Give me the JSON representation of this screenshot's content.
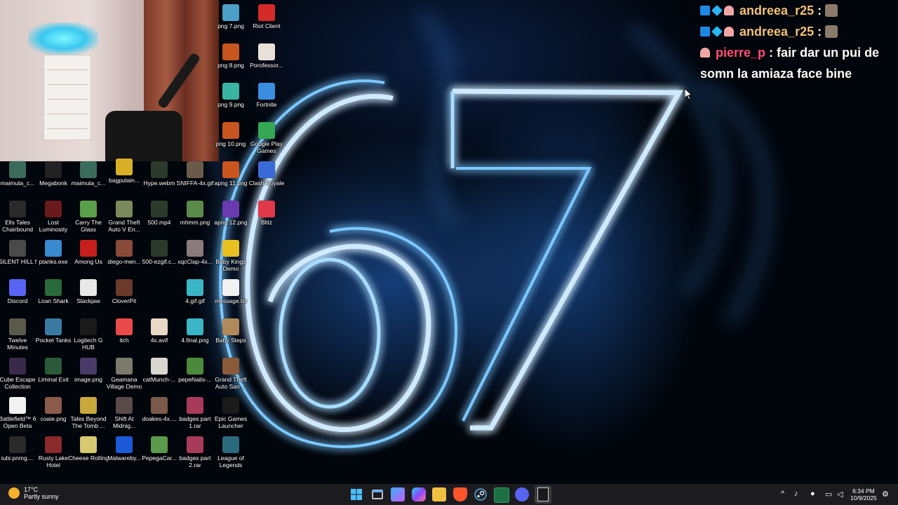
{
  "desktop": {
    "icons": [
      {
        "label": "png 7.png",
        "icon": "skull-icon",
        "color": "#4aa0c8"
      },
      {
        "label": "Riot Client",
        "icon": "riot-icon",
        "color": "#d42a2a"
      },
      {
        "label": "png 8.png",
        "icon": "skull-icon",
        "color": "#c8551e"
      },
      {
        "label": "Porofessor...",
        "icon": "poro-icon",
        "color": "#e8e0d8"
      },
      {
        "label": "png 9.png",
        "icon": "skull-icon",
        "color": "#3ab5a5"
      },
      {
        "label": "Fortnite",
        "icon": "fortnite-icon",
        "color": "#3b8de0"
      },
      {
        "label": "png 10.png",
        "icon": "skull-icon",
        "color": "#c8551e"
      },
      {
        "label": "Google Play Games",
        "icon": "play-games-icon",
        "color": "#34a853"
      },
      {
        "label": "maimuta_c...",
        "icon": "monkey-icon",
        "color": "#3b6b5a"
      },
      {
        "label": "Megabonk",
        "icon": "megabonk-icon",
        "color": "#222222"
      },
      {
        "label": "maimuta_c...",
        "icon": "monkey-icon",
        "color": "#3b6b5a"
      },
      {
        "label": "bagpulain...",
        "icon": "gold-bar-icon",
        "color": "#d8b028"
      },
      {
        "label": "Hype.webm",
        "icon": "video-icon",
        "color": "#2c3a2c"
      },
      {
        "label": "SNIFFA-4x.gif",
        "icon": "image-icon",
        "color": "#6a5a4a"
      },
      {
        "label": "apng 11.png",
        "icon": "skull-icon",
        "color": "#c8551e"
      },
      {
        "label": "Clash Royale",
        "icon": "clash-royale-icon",
        "color": "#3a6ad8"
      },
      {
        "label": "Ells Tales Chairbound",
        "icon": "game-icon",
        "color": "#2a2a2a"
      },
      {
        "label": "Lost Luminosity",
        "icon": "game-icon",
        "color": "#6a1a1a"
      },
      {
        "label": "Carry The Glass",
        "icon": "game-icon",
        "color": "#5aa04a"
      },
      {
        "label": "Grand Theft Auto V En...",
        "icon": "gta-icon",
        "color": "#7a8a5a"
      },
      {
        "label": "500.mp4",
        "icon": "video-icon",
        "color": "#2c3a2c"
      },
      {
        "label": "mhmm.png",
        "icon": "image-icon",
        "color": "#5a8a4a"
      },
      {
        "label": "apng 12.png",
        "icon": "skull-icon",
        "color": "#6a3ab0"
      },
      {
        "label": "Blitz",
        "icon": "blitz-icon",
        "color": "#e03a4a"
      },
      {
        "label": "SILENT HILL f",
        "icon": "game-icon",
        "color": "#4a4a4a"
      },
      {
        "label": "ptanks.exe",
        "icon": "tank-icon",
        "color": "#3a8ad0"
      },
      {
        "label": "Among Us",
        "icon": "among-us-icon",
        "color": "#c81e1e"
      },
      {
        "label": "diego-men...",
        "icon": "image-icon",
        "color": "#8a4a3a"
      },
      {
        "label": "500-ezgif.c...",
        "icon": "video-icon",
        "color": "#2c3a2c"
      },
      {
        "label": "xqcClap-4x...",
        "icon": "image-icon",
        "color": "#8a7a7a"
      },
      {
        "label": "Baby Kings Demo",
        "icon": "crown-icon",
        "color": "#e8c020"
      },
      {
        "label": "Discord",
        "icon": "discord-icon",
        "color": "#5865f2"
      },
      {
        "label": "Loan Shark",
        "icon": "game-icon",
        "color": "#2a6a3a"
      },
      {
        "label": "Slackjaw",
        "icon": "game-icon",
        "color": "#e8e8e8"
      },
      {
        "label": "CloverPit",
        "icon": "game-icon",
        "color": "#6a3a2a"
      },
      {
        "label": "4.gif.gif",
        "icon": "skull-icon",
        "color": "#3ab5c5"
      },
      {
        "label": "message.txt",
        "icon": "text-file-icon",
        "color": "#f2f2f2"
      },
      {
        "label": "Twelve Minutes",
        "icon": "game-icon",
        "color": "#5a5a4a"
      },
      {
        "label": "Pocket Tanks",
        "icon": "tank-icon",
        "color": "#3a7aa0"
      },
      {
        "label": "Logitech G HUB",
        "icon": "logitech-icon",
        "color": "#1a1a1a"
      },
      {
        "label": "itch",
        "icon": "itch-icon",
        "color": "#e84a4a"
      },
      {
        "label": "4x.avif",
        "icon": "image-icon",
        "color": "#e8d8c8"
      },
      {
        "label": "4.final.png",
        "icon": "skull-icon",
        "color": "#3ab5c5"
      },
      {
        "label": "Baby Steps",
        "icon": "game-icon",
        "color": "#b08a5a"
      },
      {
        "label": "Cube Escape Collection",
        "icon": "cube-icon",
        "color": "#3a2a4a"
      },
      {
        "label": "Liminal Exit",
        "icon": "game-icon",
        "color": "#2a5a3a"
      },
      {
        "label": "image.png",
        "icon": "image-icon",
        "color": "#4a3a6a"
      },
      {
        "label": "Geamana Village Demo",
        "icon": "game-icon",
        "color": "#7a7a6a"
      },
      {
        "label": "catMunch-...",
        "icon": "image-icon",
        "color": "#d8d8d0"
      },
      {
        "label": "pepeNails-...",
        "icon": "pepe-icon",
        "color": "#4a8a3a"
      },
      {
        "label": "Grand Theft Auto San ...",
        "icon": "gta-icon",
        "color": "#8a5a3a"
      },
      {
        "label": "Battlefield™ 6 Open Beta",
        "icon": "file-icon",
        "color": "#f2f2f2"
      },
      {
        "label": "coaie.png",
        "icon": "image-icon",
        "color": "#8a5a4a"
      },
      {
        "label": "Tales Beyond The Tomb ...",
        "icon": "game-icon",
        "color": "#c8a83a"
      },
      {
        "label": "Shift At Midnig...",
        "icon": "game-icon",
        "color": "#5a4a4a"
      },
      {
        "label": "doakes-4x....",
        "icon": "image-icon",
        "color": "#7a5a4a"
      },
      {
        "label": "badges part 1.rar",
        "icon": "winrar-icon",
        "color": "#a83a5a"
      },
      {
        "label": "Epic Games Launcher",
        "icon": "epic-icon",
        "color": "#1a1a1a"
      },
      {
        "label": "iubi.pnmg....",
        "icon": "file-icon",
        "color": "#2a2a2a"
      },
      {
        "label": "Rusty Lake Hotel",
        "icon": "game-icon",
        "color": "#8a2a2a"
      },
      {
        "label": "Cheese Rolling",
        "icon": "game-icon",
        "color": "#d8c870"
      },
      {
        "label": "Malwareby...",
        "icon": "malwarebytes-icon",
        "color": "#1a5ad8"
      },
      {
        "label": "PepegaCar...",
        "icon": "image-icon",
        "color": "#5a9a4a"
      },
      {
        "label": "badges part 2.rar",
        "icon": "winrar-icon",
        "color": "#a83a5a"
      },
      {
        "label": "League of Legends",
        "icon": "league-icon",
        "color": "#2a6a7a"
      }
    ]
  },
  "chat": {
    "messages": [
      {
        "user": "andreea_r25",
        "text": " :",
        "emote": "emote-icon"
      },
      {
        "user": "andreea_r25",
        "text": " :",
        "emote": "emote-icon"
      },
      {
        "user": "pierre_p",
        "text": " : fair dar un pui de somn la amiaza face bine"
      }
    ]
  },
  "taskbar": {
    "weather_temp": "17°C",
    "weather_desc": "Partly sunny",
    "apps": [
      "windows-start-icon",
      "task-view-icon",
      "copilot-icon",
      "copilot-app-icon",
      "file-explorer-icon",
      "brave-icon",
      "steam-icon",
      "excel-icon",
      "discord-icon",
      "epic-games-icon"
    ],
    "time": "6:34 PM",
    "date": "10/9/2025"
  },
  "wallpaper": {
    "text": "67",
    "accent": "#4fb0ff"
  }
}
